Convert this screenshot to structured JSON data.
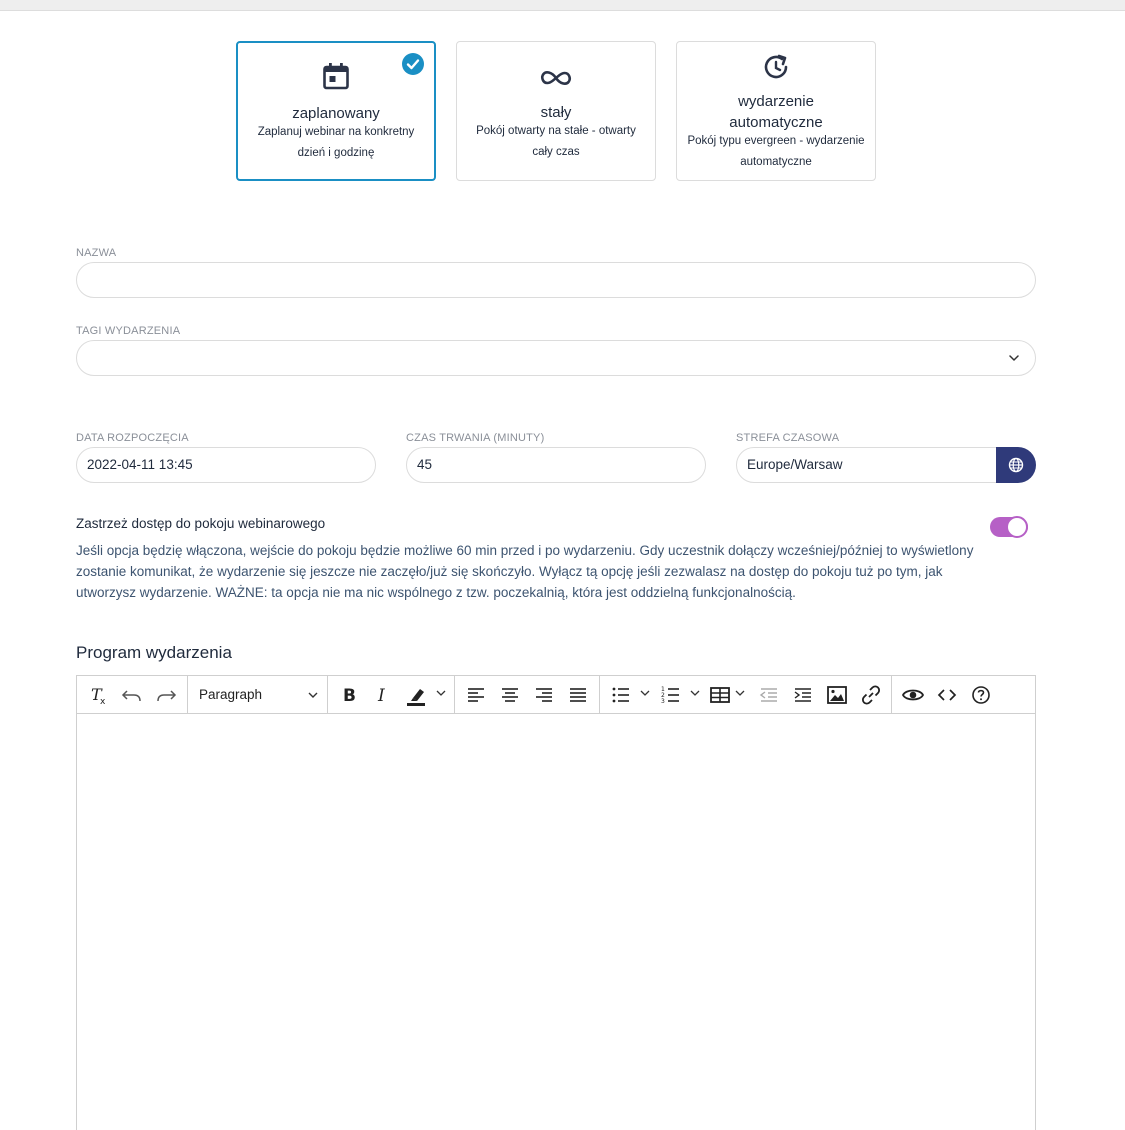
{
  "event_types": [
    {
      "title": "zaplanowany",
      "description": "Zaplanuj webinar na konkretny dzień i godzinę",
      "icon": "calendar-icon",
      "selected": true
    },
    {
      "title": "stały",
      "description": "Pokój otwarty na stałe - otwarty cały czas",
      "icon": "infinity-icon",
      "selected": false
    },
    {
      "title": "wydarzenie automatyczne",
      "description": "Pokój typu evergreen - wydarzenie automatyczne",
      "icon": "clock-refresh-icon",
      "selected": false
    }
  ],
  "form": {
    "name_label": "NAZWA",
    "name_value": "",
    "tags_label": "TAGI WYDARZENIA",
    "tags_value": "",
    "start_label": "DATA ROZPOCZĘCIA",
    "start_value": "2022-04-11 13:45",
    "duration_label": "CZAS TRWANIA (MINUTY)",
    "duration_value": "45",
    "timezone_label": "STREFA CZASOWA",
    "timezone_value": "Europe/Warsaw"
  },
  "restrict": {
    "title": "Zastrzeż dostęp do pokoju webinarowego",
    "description": "Jeśli opcja będzię włączona, wejście do pokoju będzie możliwe 60 min przed i po wydarzeniu. Gdy uczestnik dołączy wcześniej/później to wyświetlony zostanie komunikat, że wydarzenie się jeszcze nie zaczęło/już się skończyło. Wyłącz tą opcję jeśli zezwalasz na dostęp do pokoju tuż po tym, jak utworzysz wydarzenie. WAŻNE: ta opcja nie ma nic wspólnego z tzw. poczekalnią, która jest oddzielną funkcjonalnością.",
    "enabled": true
  },
  "program": {
    "title": "Program wydarzenia",
    "block_format": "Paragraph",
    "content": ""
  },
  "colors": {
    "accent": "#1a8fc4",
    "toggle": "#b660c6",
    "globe_button": "#2f3a7a"
  }
}
